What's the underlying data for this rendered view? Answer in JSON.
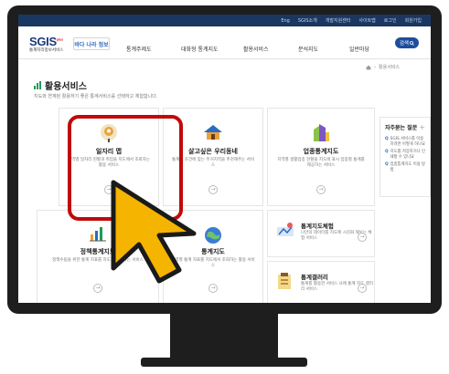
{
  "util_links": [
    "Eng",
    "SGIS소개",
    "개발지원센터",
    "사이트맵",
    "로그인",
    "회원가입"
  ],
  "logo": {
    "main": "SGIS",
    "plus": "plus",
    "sub": "통계지리정보서비스"
  },
  "badge": "바다 나라 정보",
  "nav": [
    "통계주제도",
    "대화형 통계지도",
    "활용서비스",
    "분석지도",
    "일반마당"
  ],
  "search_label": "검색",
  "breadcrumb": {
    "sep": "›",
    "current": "활용서비스"
  },
  "page": {
    "title": "활용서비스",
    "description": "지도와 연계된 활용하기 좋은 통계서비스를 선택하고 체험합니다."
  },
  "cards": [
    {
      "title": "일자리 맵",
      "desc": "지역별 일자리 현황과 취업을 지도에서 조회하는 활용 서비스",
      "arrow": "→"
    },
    {
      "title": "살고싶은 우리동네",
      "desc": "통계는 조건에 맞는 주거지역을 추천해주는 서비스",
      "arrow": "→"
    },
    {
      "title": "업종통계지도",
      "desc": "지역별 생활업종 현황을 지도에 표시 업종별 통계를 제공하는 서비스",
      "arrow": "→"
    },
    {
      "title": "정책통계지도",
      "desc": "정책수립을 위한 통계 지표를 지도로 표현하는 서비스",
      "arrow": "→"
    },
    {
      "title": "통계지도",
      "desc": "지역별 통계 자료를 지도에서 조회하는 활용 서비스",
      "arrow": "→"
    }
  ],
  "wide_cards": [
    {
      "title": "통계지도체험",
      "desc": "나만의 데이터를 지도에 시각화 해보는 체험 서비스",
      "arrow": "→"
    },
    {
      "title": "통계갤러리",
      "desc": "통계를 활용한 서비스 사례 통계 지도 갤러리 서비스",
      "arrow": "→"
    }
  ],
  "faq": {
    "title": "자주묻는 질문",
    "plus": "+",
    "items": [
      {
        "q": "Q",
        "text": "SGIS 서비스를 이용하려면 어떻게 하나요"
      },
      {
        "q": "Q",
        "text": "지도를 저장하거나 인쇄할 수 있나요"
      },
      {
        "q": "Q",
        "text": "업종통계지도 이용 방법"
      }
    ]
  },
  "colors": {
    "accent": "#1d4e9e",
    "highlight": "#c10a0a",
    "cursor": "#f5b400",
    "brand": "#1a3762"
  }
}
